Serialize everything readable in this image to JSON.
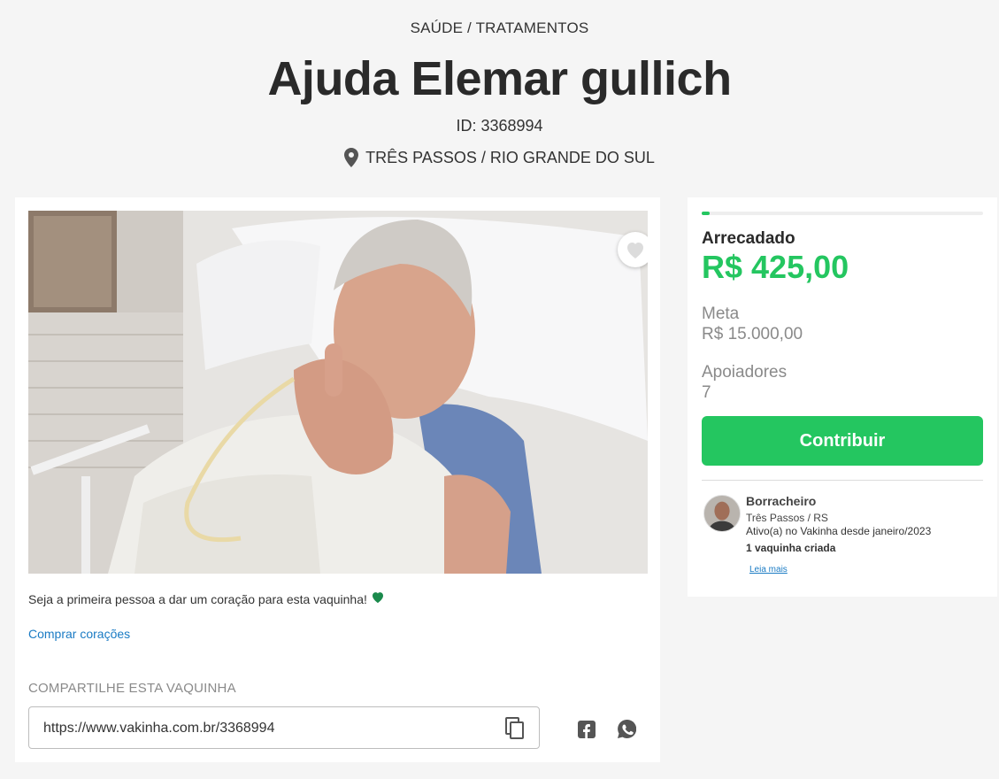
{
  "header": {
    "category": "SAÚDE / TRATAMENTOS",
    "title": "Ajuda Elemar gullich",
    "campaign_id": "ID: 3368994",
    "location": "TRÊS PASSOS / RIO GRANDE DO SUL",
    "location_icon": "map-pin-icon"
  },
  "main": {
    "photo_alt": "Foto da campanha",
    "favorite_icon": "heart-outline-icon",
    "hearts_message": "Seja a primeira pessoa a dar um coração para esta vaquinha!",
    "hearts_icon": "green-heart-icon",
    "buy_hearts_link": "Comprar corações",
    "share": {
      "title": "COMPARTILHE ESTA VAQUINHA",
      "url": "https://www.vakinha.com.br/3368994",
      "copy_icon": "copy-icon",
      "facebook_icon": "facebook-icon",
      "whatsapp_icon": "whatsapp-icon"
    }
  },
  "sidebar": {
    "progress_fraction": 0.028,
    "raised_label": "Arrecadado",
    "raised_value": "R$ 425,00",
    "goal_label": "Meta",
    "goal_value": "R$ 15.000,00",
    "supporters_label": "Apoiadores",
    "supporters_value": "7",
    "contribute_button": "Contribuir",
    "creator": {
      "name": "Borracheiro",
      "location": "Três Passos / RS",
      "active_since": "Ativo(a) no Vakinha desde janeiro/2023",
      "campaigns_created": "1 vaquinha criada",
      "read_more": "Leia mais"
    }
  },
  "colors": {
    "accent_green": "#24c660",
    "link_blue": "#1a7bc4",
    "page_background": "#f5f5f5"
  }
}
